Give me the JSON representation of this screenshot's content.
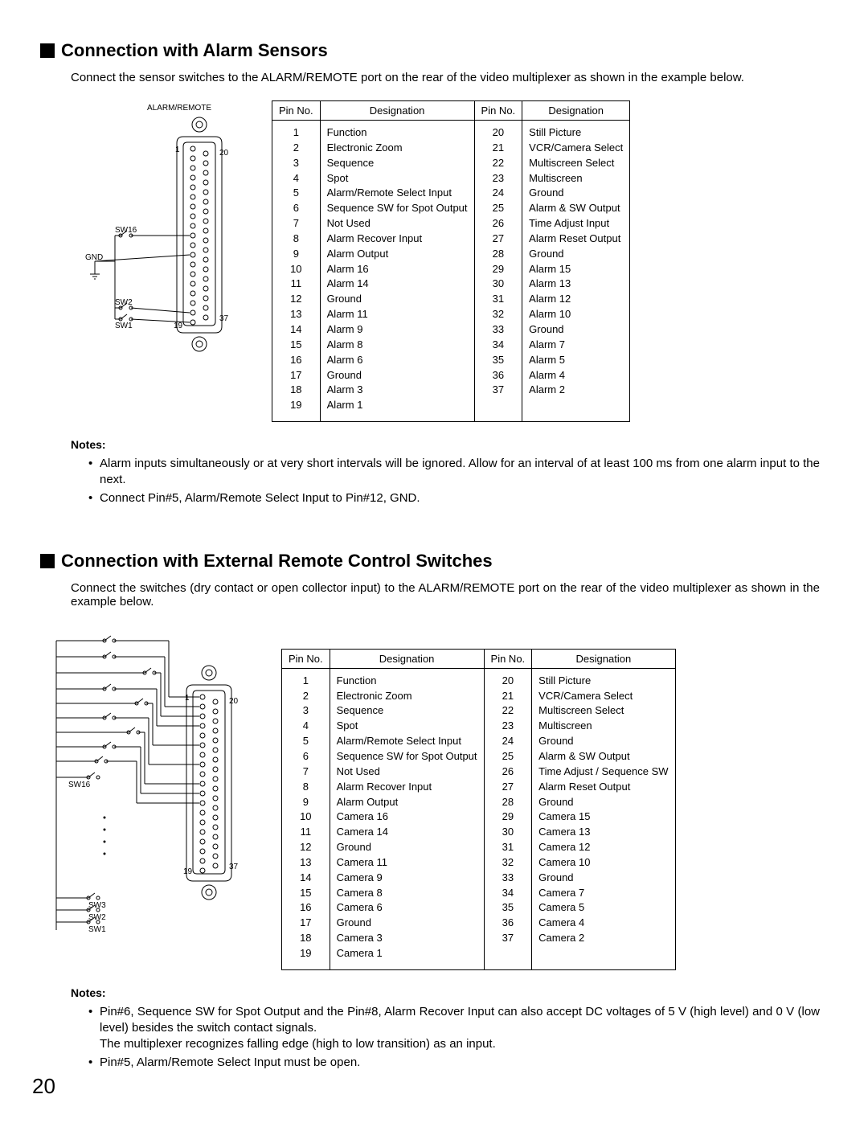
{
  "section1": {
    "heading": "Connection with Alarm Sensors",
    "intro": "Connect the sensor switches to the ALARM/REMOTE port on the rear of the video multiplexer as shown in the example below.",
    "connector_label": "ALARM/REMOTE",
    "diagram_labels": {
      "pin1": "1",
      "pin19": "19",
      "pin20": "20",
      "pin37": "37",
      "sw16": "SW16",
      "sw2": "SW2",
      "sw1": "SW1",
      "gnd": "GND"
    },
    "table": {
      "hdr_pin": "Pin No.",
      "hdr_des": "Designation",
      "left_pins": "1\n2\n3\n4\n5\n6\n7\n8\n9\n10\n11\n12\n13\n14\n15\n16\n17\n18\n19",
      "left_des": "Function\nElectronic Zoom\nSequence\nSpot\nAlarm/Remote Select Input\nSequence SW for Spot Output\nNot Used\nAlarm Recover Input\nAlarm Output\nAlarm 16\nAlarm 14\nGround\nAlarm 11\nAlarm 9\nAlarm 8\nAlarm 6\nGround\nAlarm 3\nAlarm 1",
      "right_pins": "20\n21\n22\n23\n24\n25\n26\n27\n28\n29\n30\n31\n32\n33\n34\n35\n36\n37",
      "right_des": "Still Picture\nVCR/Camera Select\nMultiscreen Select\nMultiscreen\nGround\nAlarm & SW Output\nTime Adjust Input\nAlarm Reset Output\nGround\nAlarm 15\nAlarm 13\nAlarm 12\nAlarm 10\nGround\nAlarm 7\nAlarm 5\nAlarm 4\nAlarm 2"
    },
    "notes_heading": "Notes:",
    "notes": [
      "Alarm inputs simultaneously or at very short intervals will be ignored. Allow for an interval of at least 100 ms from one alarm input to the next.",
      "Connect Pin#5, Alarm/Remote Select Input to Pin#12, GND."
    ]
  },
  "section2": {
    "heading": "Connection with External Remote Control Switches",
    "intro": "Connect the switches (dry contact or open collector input) to the ALARM/REMOTE port on the rear of the video multiplexer as shown in the example below.",
    "diagram_labels": {
      "pin1": "1",
      "pin19": "19",
      "pin20": "20",
      "pin37": "37",
      "sw16": "SW16",
      "sw3": "SW3",
      "sw2": "SW2",
      "sw1": "SW1"
    },
    "table": {
      "hdr_pin": "Pin No.",
      "hdr_des": "Designation",
      "left_pins": "1\n2\n3\n4\n5\n6\n7\n8\n9\n10\n11\n12\n13\n14\n15\n16\n17\n18\n19",
      "left_des": "Function\nElectronic Zoom\nSequence\nSpot\nAlarm/Remote Select Input\nSequence SW for Spot Output\nNot Used\nAlarm Recover Input\nAlarm Output\nCamera 16\nCamera 14\nGround\nCamera 11\nCamera 9\nCamera 8\nCamera 6\nGround\nCamera 3\nCamera 1",
      "right_pins": "20\n21\n22\n23\n24\n25\n26\n27\n28\n29\n30\n31\n32\n33\n34\n35\n36\n37",
      "right_des": "Still Picture\nVCR/Camera Select\nMultiscreen Select\nMultiscreen\nGround\nAlarm & SW Output\nTime Adjust / Sequence SW\nAlarm Reset Output\nGround\nCamera 15\nCamera 13\nCamera 12\nCamera 10\nGround\nCamera 7\nCamera 5\nCamera 4\nCamera 2"
    },
    "notes_heading": "Notes:",
    "notes": [
      "Pin#6, Sequence SW for Spot Output and the Pin#8, Alarm Recover Input can also accept DC voltages of 5 V (high level) and 0 V (low level) besides the switch contact signals.\nThe multiplexer recognizes falling edge (high to low transition) as an input.",
      "Pin#5, Alarm/Remote Select Input must be open."
    ]
  },
  "page_number": "20"
}
